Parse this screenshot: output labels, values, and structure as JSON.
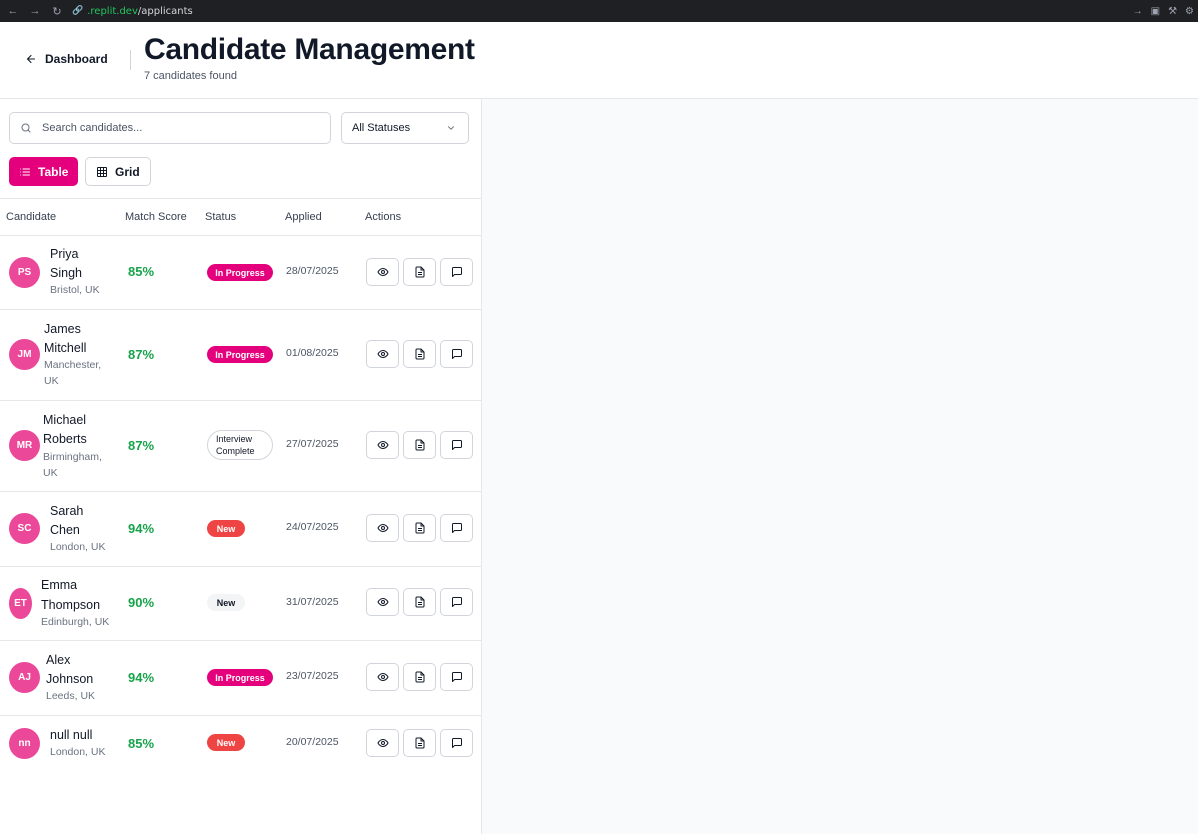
{
  "browser": {
    "host": ".replit.dev",
    "path": "/applicants"
  },
  "header": {
    "back_label": "Dashboard",
    "title": "Candidate Management",
    "subtitle": "7 candidates found"
  },
  "filters": {
    "search_placeholder": "Search candidates...",
    "status_value": "All Statuses"
  },
  "view_toggle": {
    "table_label": "Table",
    "grid_label": "Grid",
    "active": "Table"
  },
  "table": {
    "columns": [
      "Candidate",
      "Match Score",
      "Status",
      "Applied",
      "Actions"
    ],
    "rows": [
      {
        "initials": "PS",
        "name_line1": "Priya",
        "name_line2": "Singh",
        "location_line1": "Bristol, UK",
        "location_line2": "",
        "score": "85%",
        "status": "In Progress",
        "applied": "28/07/2025"
      },
      {
        "initials": "JM",
        "name_line1": "James",
        "name_line2": "Mitchell",
        "location_line1": "Manchester,",
        "location_line2": "UK",
        "score": "87%",
        "status": "In Progress",
        "applied": "01/08/2025"
      },
      {
        "initials": "MR",
        "name_line1": "Michael",
        "name_line2": "Roberts",
        "location_line1": "Birmingham,",
        "location_line2": "UK",
        "score": "87%",
        "status_line1": "Interview",
        "status_line2": "Complete",
        "applied": "27/07/2025"
      },
      {
        "initials": "SC",
        "name_line1": "Sarah",
        "name_line2": "Chen",
        "location_line1": "London, UK",
        "location_line2": "",
        "score": "94%",
        "status": "New",
        "applied": "24/07/2025"
      },
      {
        "initials": "ET",
        "name_line1": "Emma",
        "name_line2": "Thompson",
        "location_line1": "Edinburgh, UK",
        "location_line2": "",
        "score": "90%",
        "status": "New",
        "applied": "31/07/2025"
      },
      {
        "initials": "AJ",
        "name_line1": "Alex",
        "name_line2": "Johnson",
        "location_line1": "Leeds, UK",
        "location_line2": "",
        "score": "94%",
        "status": "In Progress",
        "applied": "23/07/2025"
      },
      {
        "initials": "nn",
        "name_line1": "null null",
        "name_line2": "",
        "location_line1": "London, UK",
        "location_line2": "",
        "score": "85%",
        "status": "New",
        "applied": "20/07/2025"
      }
    ]
  },
  "colors": {
    "accent": "#e4007c",
    "avatar": "#ec4899",
    "score": "#16a34a",
    "new_badge": "#ef4444"
  }
}
